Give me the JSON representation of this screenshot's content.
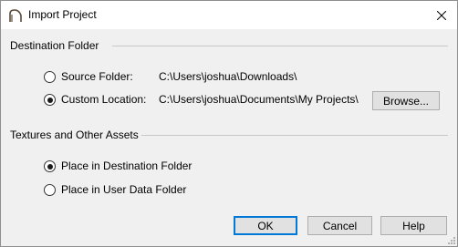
{
  "window": {
    "title": "Import Project",
    "app_icon": "arc-icon",
    "close_icon": "close-icon"
  },
  "destination": {
    "group_label": "Destination Folder",
    "source_label": "Source Folder:",
    "source_path": "C:\\Users\\joshua\\Downloads\\",
    "source_selected": false,
    "custom_label": "Custom Location:",
    "custom_path": "C:\\Users\\joshua\\Documents\\My Projects\\",
    "custom_selected": true,
    "browse_label": "Browse..."
  },
  "textures": {
    "group_label": "Textures and Other Assets",
    "dest_label": "Place in Destination Folder",
    "dest_selected": true,
    "user_label": "Place in User Data Folder",
    "user_selected": false
  },
  "buttons": {
    "ok": "OK",
    "cancel": "Cancel",
    "help": "Help"
  },
  "colors": {
    "default_button_border": "#0078d7",
    "dialog_bg": "#f0f0f0"
  }
}
